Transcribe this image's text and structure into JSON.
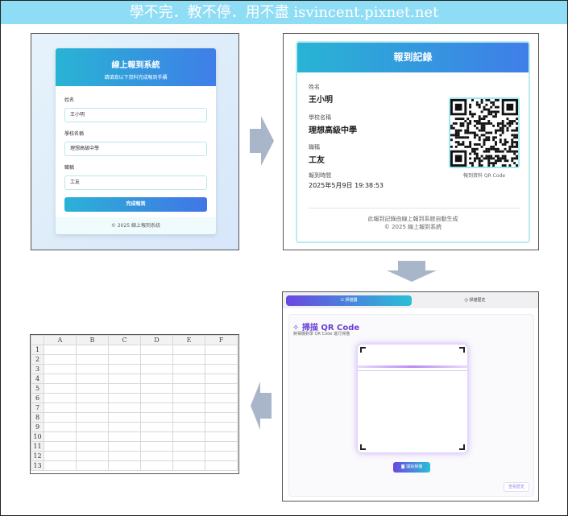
{
  "banner": {
    "text": "學不完．教不停．用不盡 isvincent.pixnet.net"
  },
  "login_form": {
    "title": "線上報到系統",
    "subtitle": "請填寫以下資料完成報到手續",
    "fields": [
      {
        "label": "姓名",
        "value": "王小明"
      },
      {
        "label": "學校名稱",
        "value": "理想高級中學"
      },
      {
        "label": "職稱",
        "value": "工友"
      }
    ],
    "submit_label": "完成報到",
    "footer": "© 2025 線上報到系統"
  },
  "record": {
    "title": "報到記錄",
    "name_label": "姓名",
    "name": "王小明",
    "school_label": "學校名稱",
    "school": "理想高級中學",
    "job_label": "職稱",
    "job": "工友",
    "time_label": "報到時間",
    "time": "2025年5月9日 19:38:53",
    "qr_caption": "報到資料 QR Code",
    "footer_line1": "此報到記錄由線上報到系統自動生成",
    "footer_line2": "© 2025 線上報到系統"
  },
  "scanner": {
    "tab_scan": "掃描器",
    "tab_history": "掃描歷史",
    "title": "掃描 QR Code",
    "subtitle": "將相機對準 QR Code 進行掃描",
    "start_button": "開始掃描",
    "history_button": "查看歷史"
  },
  "spreadsheet": {
    "columns": [
      "A",
      "B",
      "C",
      "D",
      "E",
      "F"
    ],
    "rows": [
      "1",
      "2",
      "3",
      "4",
      "5",
      "6",
      "7",
      "8",
      "9",
      "10",
      "11",
      "12",
      "13"
    ]
  },
  "colors": {
    "banner": "#8fdcf5",
    "header_gradient_start": "#28b4d4",
    "header_gradient_end": "#3f7ee8",
    "scanner_accent": "#6b47e0",
    "arrow": "#a9b6c9"
  }
}
